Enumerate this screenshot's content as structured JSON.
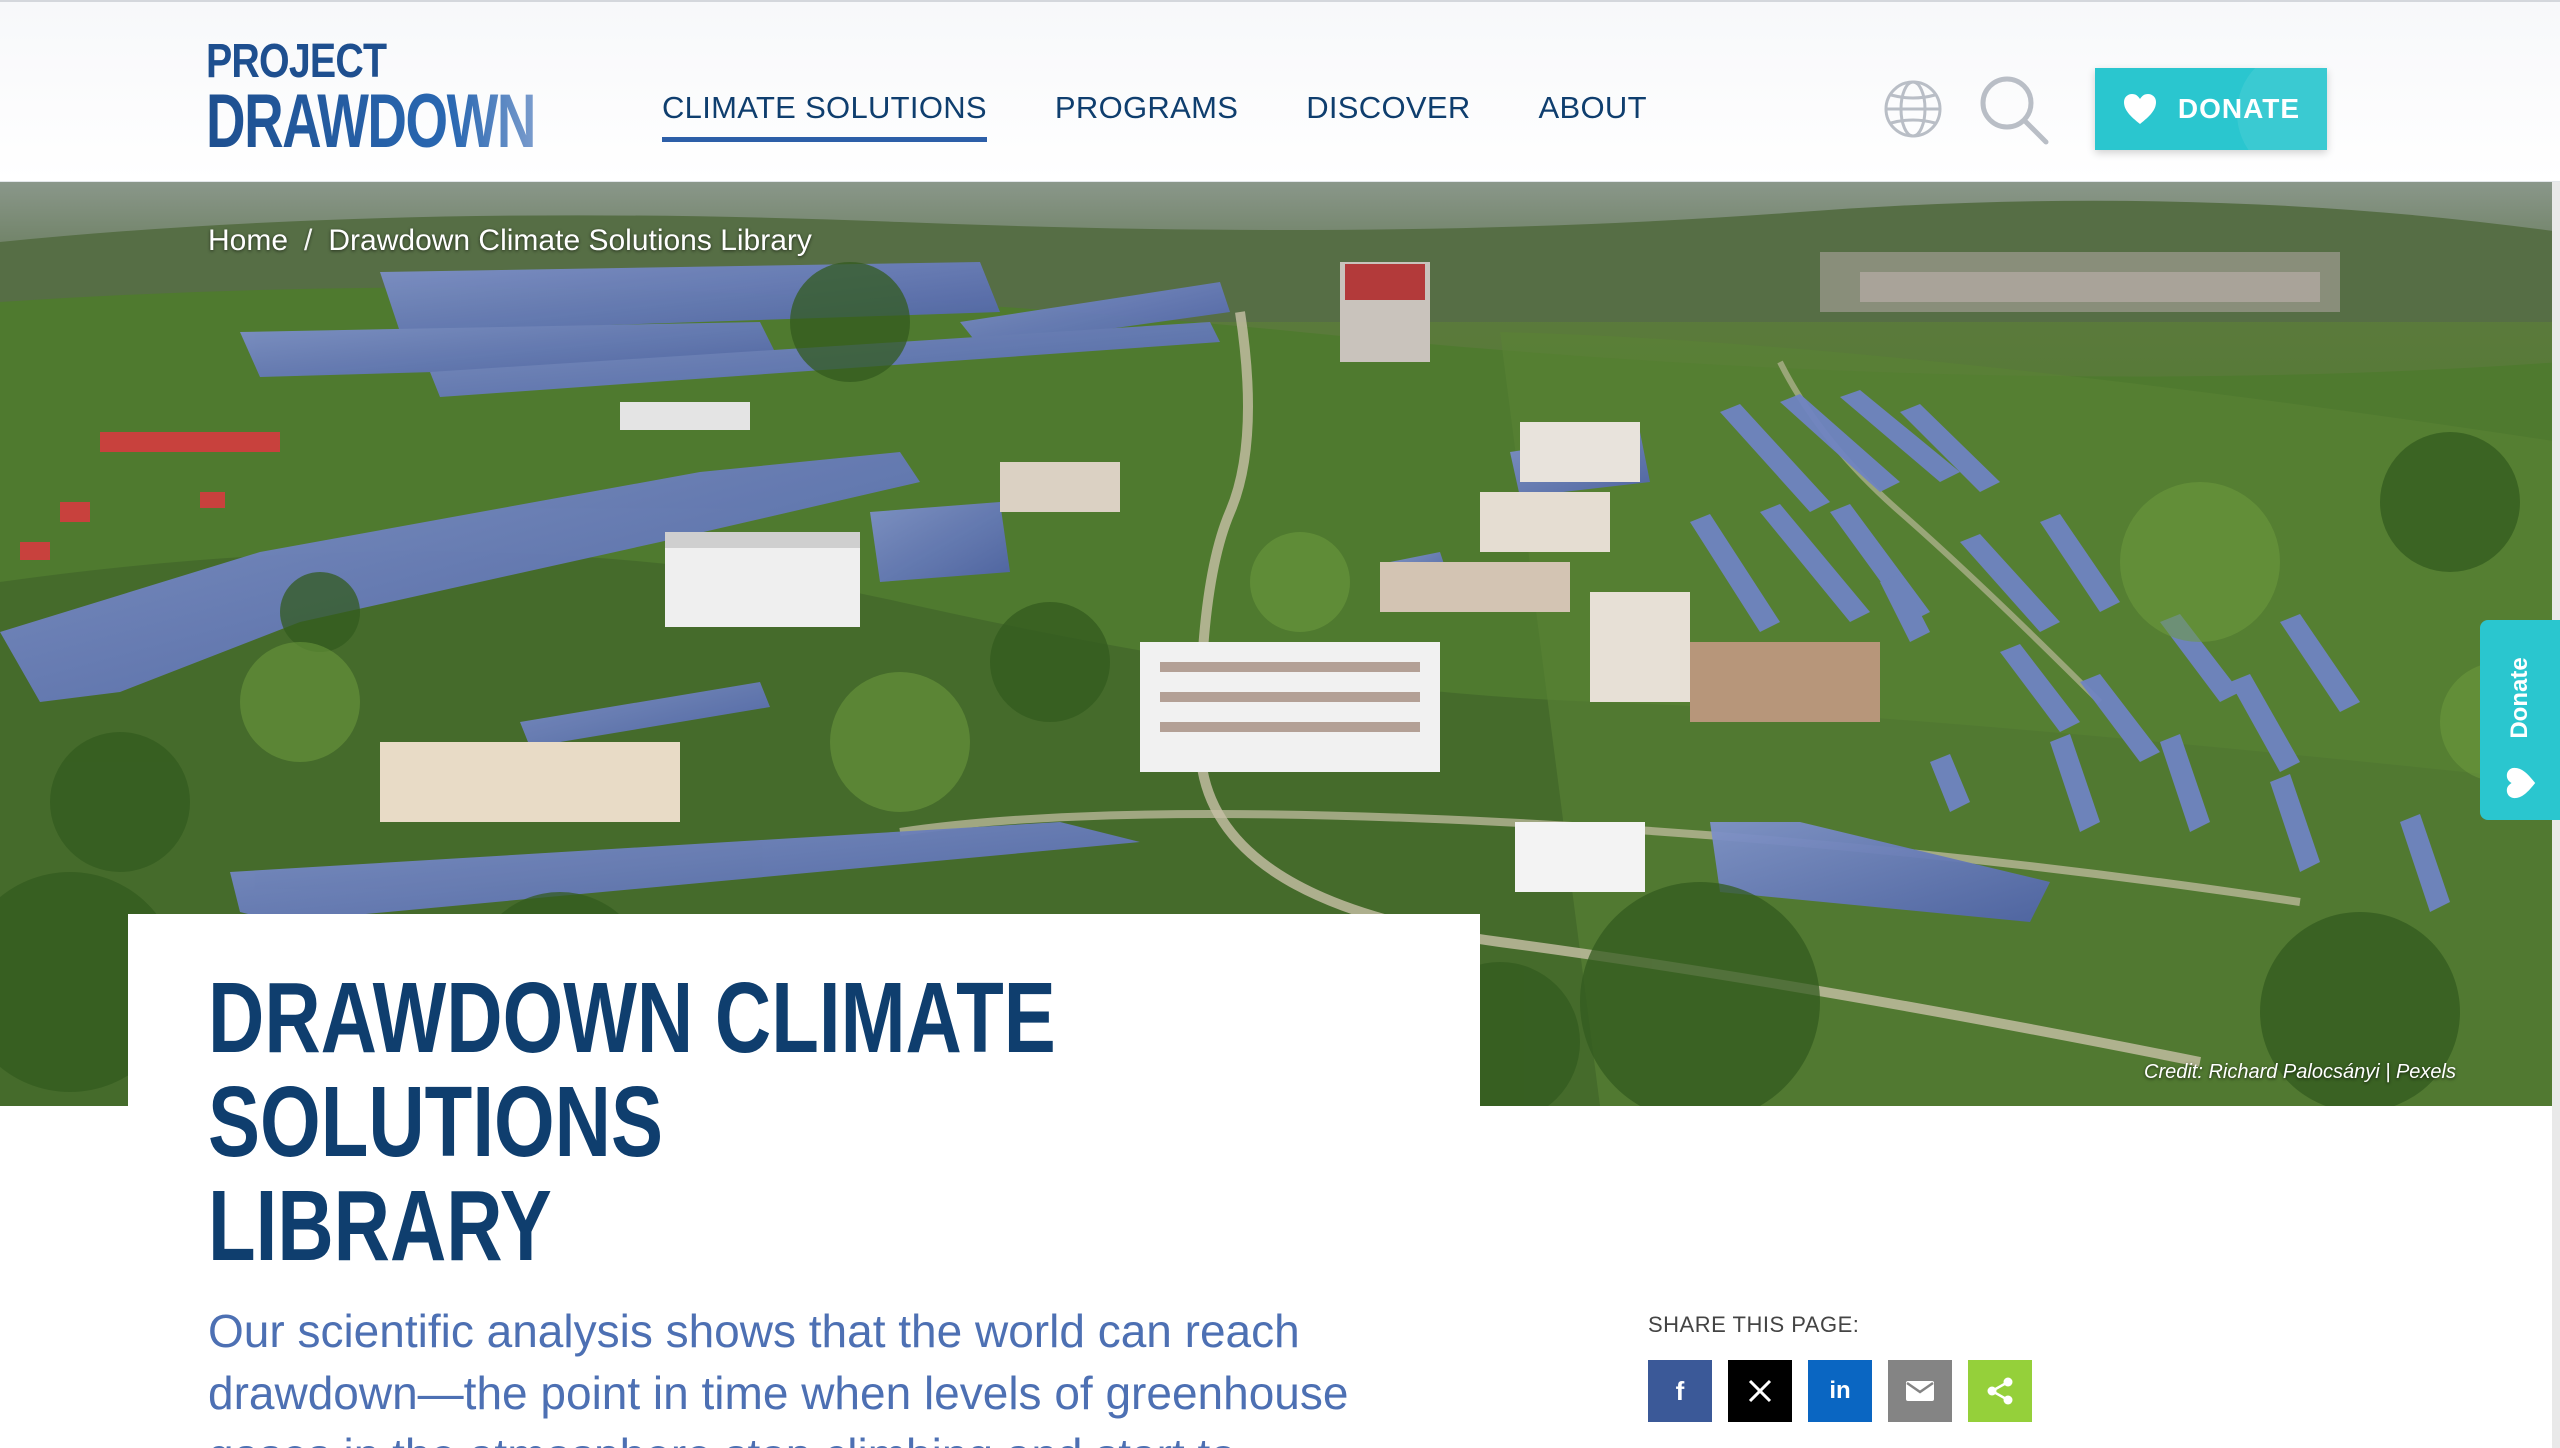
{
  "header": {
    "logo_line1": "PROJECT",
    "logo_line2": "DRAWDOWN",
    "nav": [
      {
        "label": "CLIMATE SOLUTIONS",
        "active": true
      },
      {
        "label": "PROGRAMS",
        "active": false
      },
      {
        "label": "DISCOVER",
        "active": false
      },
      {
        "label": "ABOUT",
        "active": false
      }
    ],
    "icons": [
      "globe-icon",
      "search-icon"
    ],
    "donate_label": "DONATE"
  },
  "hero": {
    "breadcrumb": {
      "home": "Home",
      "separator": "/",
      "current": "Drawdown Climate Solutions Library"
    },
    "credit": "Credit: Richard Palocsányi | Pexels"
  },
  "title": {
    "line1": "DRAWDOWN CLIMATE SOLUTIONS",
    "line2": "LIBRARY"
  },
  "side_tab": {
    "label": "Donate"
  },
  "body": {
    "intro": "Our scientific analysis shows that the world can reach drawdown—the point in time when levels of greenhouse gases in the atmosphere stop climbing and start to"
  },
  "share": {
    "label": "SHARE THIS PAGE:",
    "buttons": [
      {
        "network": "facebook",
        "glyph": "f"
      },
      {
        "network": "x",
        "glyph": "𝕏"
      },
      {
        "network": "linkedin",
        "glyph": "in"
      },
      {
        "network": "email",
        "glyph": "✉"
      },
      {
        "network": "share",
        "glyph": "share"
      }
    ]
  },
  "colors": {
    "brand_blue": "#0f3e6e",
    "accent_teal": "#2ac6cf",
    "intro_blue": "#4d70b3",
    "facebook": "#3b5998",
    "linkedin": "#0a66c2",
    "share_green": "#95d03a"
  }
}
